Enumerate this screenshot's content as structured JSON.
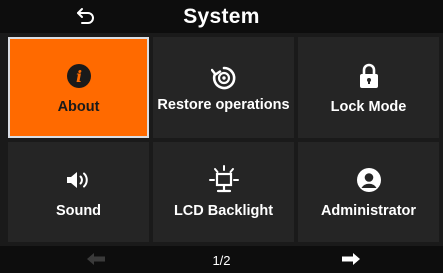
{
  "header": {
    "title": "System",
    "back_icon": "back-arrow-icon"
  },
  "tiles": [
    {
      "label": "About",
      "icon": "info-icon",
      "selected": true
    },
    {
      "label": "Restore operations",
      "icon": "restore-icon",
      "selected": false
    },
    {
      "label": "Lock Mode",
      "icon": "lock-icon",
      "selected": false
    },
    {
      "label": "Sound",
      "icon": "speaker-icon",
      "selected": false
    },
    {
      "label": "LCD Backlight",
      "icon": "backlight-icon",
      "selected": false
    },
    {
      "label": "Administrator",
      "icon": "user-icon",
      "selected": false
    }
  ],
  "footer": {
    "page": "1/2",
    "prev_enabled": false,
    "next_enabled": true
  },
  "colors": {
    "accent": "#ff6a00",
    "tile_bg": "#252525",
    "bar_bg": "#0d0d0d",
    "page_bg": "#1a1a1a"
  }
}
